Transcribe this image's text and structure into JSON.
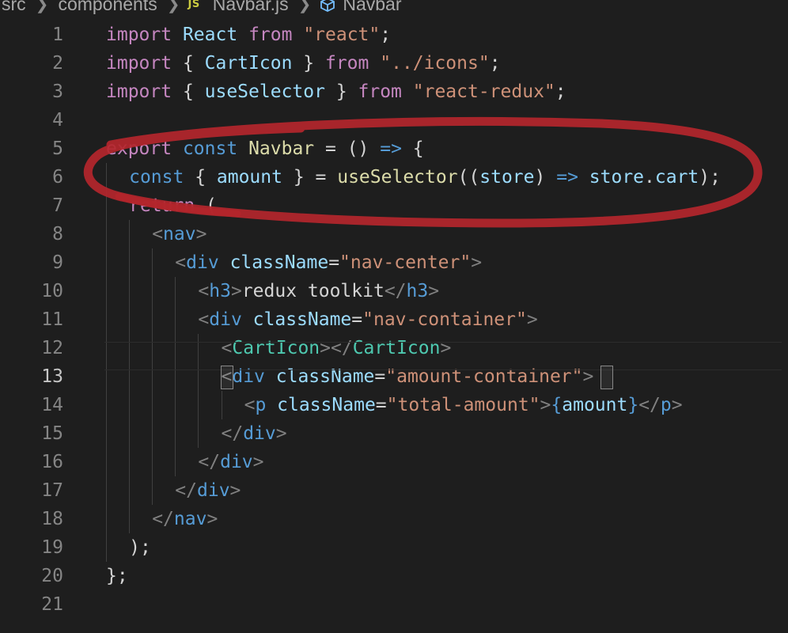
{
  "breadcrumb": {
    "segments": [
      "src",
      "components",
      "Navbar.js",
      "Navbar"
    ],
    "file_icon_label": "JS"
  },
  "editor": {
    "active_line": 13,
    "colors": {
      "background": "#1e1e1e",
      "annotation": "#b4262c"
    },
    "lines": [
      {
        "n": "1",
        "indent": 0,
        "tokens": [
          [
            "kw",
            "import"
          ],
          [
            "pun",
            " "
          ],
          [
            "var",
            "React"
          ],
          [
            "pun",
            " "
          ],
          [
            "kw",
            "from"
          ],
          [
            "pun",
            " "
          ],
          [
            "str",
            "\"react\""
          ],
          [
            "pun",
            ";"
          ]
        ]
      },
      {
        "n": "2",
        "indent": 0,
        "tokens": [
          [
            "kw",
            "import"
          ],
          [
            "pun",
            " { "
          ],
          [
            "var",
            "CartIcon"
          ],
          [
            "pun",
            " } "
          ],
          [
            "kw",
            "from"
          ],
          [
            "pun",
            " "
          ],
          [
            "str",
            "\"../icons\""
          ],
          [
            "pun",
            ";"
          ]
        ]
      },
      {
        "n": "3",
        "indent": 0,
        "tokens": [
          [
            "kw",
            "import"
          ],
          [
            "pun",
            " { "
          ],
          [
            "var",
            "useSelector"
          ],
          [
            "pun",
            " } "
          ],
          [
            "kw",
            "from"
          ],
          [
            "pun",
            " "
          ],
          [
            "str",
            "\"react-redux\""
          ],
          [
            "pun",
            ";"
          ]
        ]
      },
      {
        "n": "4",
        "indent": 0,
        "tokens": []
      },
      {
        "n": "5",
        "indent": 0,
        "tokens": [
          [
            "kw",
            "export"
          ],
          [
            "pun",
            " "
          ],
          [
            "st",
            "const"
          ],
          [
            "pun",
            " "
          ],
          [
            "fn",
            "Navbar"
          ],
          [
            "pun",
            " = () "
          ],
          [
            "st",
            "=>"
          ],
          [
            "pun",
            " {"
          ]
        ]
      },
      {
        "n": "6",
        "indent": 1,
        "tokens": [
          [
            "st",
            "const"
          ],
          [
            "pun",
            " { "
          ],
          [
            "var",
            "amount"
          ],
          [
            "pun",
            " } = "
          ],
          [
            "fn",
            "useSelector"
          ],
          [
            "pun",
            "(("
          ],
          [
            "var",
            "store"
          ],
          [
            "pun",
            ") "
          ],
          [
            "st",
            "=>"
          ],
          [
            "pun",
            " "
          ],
          [
            "var",
            "store"
          ],
          [
            "pun",
            "."
          ],
          [
            "var",
            "cart"
          ],
          [
            "pun",
            ");"
          ]
        ]
      },
      {
        "n": "7",
        "indent": 1,
        "tokens": [
          [
            "kw",
            "return"
          ],
          [
            "pun",
            " ("
          ]
        ]
      },
      {
        "n": "8",
        "indent": 2,
        "tokens": [
          [
            "tpu",
            "<"
          ],
          [
            "tag",
            "nav"
          ],
          [
            "tpu",
            ">"
          ]
        ]
      },
      {
        "n": "9",
        "indent": 3,
        "tokens": [
          [
            "tpu",
            "<"
          ],
          [
            "tag",
            "div"
          ],
          [
            "pun",
            " "
          ],
          [
            "att",
            "className"
          ],
          [
            "pun",
            "="
          ],
          [
            "str",
            "\"nav-center\""
          ],
          [
            "tpu",
            ">"
          ]
        ]
      },
      {
        "n": "10",
        "indent": 4,
        "tokens": [
          [
            "tpu",
            "<"
          ],
          [
            "tag",
            "h3"
          ],
          [
            "tpu",
            ">"
          ],
          [
            "txt",
            "redux toolkit"
          ],
          [
            "tpu",
            "</"
          ],
          [
            "tag",
            "h3"
          ],
          [
            "tpu",
            ">"
          ]
        ]
      },
      {
        "n": "11",
        "indent": 4,
        "tokens": [
          [
            "tpu",
            "<"
          ],
          [
            "tag",
            "div"
          ],
          [
            "pun",
            " "
          ],
          [
            "att",
            "className"
          ],
          [
            "pun",
            "="
          ],
          [
            "str",
            "\"nav-container\""
          ],
          [
            "tpu",
            ">"
          ]
        ]
      },
      {
        "n": "12",
        "indent": 5,
        "tokens": [
          [
            "tpu",
            "<"
          ],
          [
            "cmp",
            "CartIcon"
          ],
          [
            "tpu",
            "></"
          ],
          [
            "cmp",
            "CartIcon"
          ],
          [
            "tpu",
            ">"
          ]
        ]
      },
      {
        "n": "13",
        "indent": 5,
        "tokens": [
          [
            "tpu",
            "<"
          ],
          [
            "tag",
            "div"
          ],
          [
            "pun",
            " "
          ],
          [
            "att",
            "className"
          ],
          [
            "pun",
            "="
          ],
          [
            "str",
            "\"amount-container\""
          ],
          [
            "tpu",
            ">"
          ]
        ]
      },
      {
        "n": "14",
        "indent": 6,
        "tokens": [
          [
            "tpu",
            "<"
          ],
          [
            "tag",
            "p"
          ],
          [
            "pun",
            " "
          ],
          [
            "att",
            "className"
          ],
          [
            "pun",
            "="
          ],
          [
            "str",
            "\"total-amount\""
          ],
          [
            "tpu",
            ">"
          ],
          [
            "st",
            "{"
          ],
          [
            "var",
            "amount"
          ],
          [
            "st",
            "}"
          ],
          [
            "tpu",
            "</"
          ],
          [
            "tag",
            "p"
          ],
          [
            "tpu",
            ">"
          ]
        ]
      },
      {
        "n": "15",
        "indent": 5,
        "tokens": [
          [
            "tpu",
            "</"
          ],
          [
            "tag",
            "div"
          ],
          [
            "tpu",
            ">"
          ]
        ]
      },
      {
        "n": "16",
        "indent": 4,
        "tokens": [
          [
            "tpu",
            "</"
          ],
          [
            "tag",
            "div"
          ],
          [
            "tpu",
            ">"
          ]
        ]
      },
      {
        "n": "17",
        "indent": 3,
        "tokens": [
          [
            "tpu",
            "</"
          ],
          [
            "tag",
            "div"
          ],
          [
            "tpu",
            ">"
          ]
        ]
      },
      {
        "n": "18",
        "indent": 2,
        "tokens": [
          [
            "tpu",
            "</"
          ],
          [
            "tag",
            "nav"
          ],
          [
            "tpu",
            ">"
          ]
        ]
      },
      {
        "n": "19",
        "indent": 1,
        "tokens": [
          [
            "pun",
            ");"
          ]
        ]
      },
      {
        "n": "20",
        "indent": 0,
        "tokens": [
          [
            "pun",
            "};"
          ]
        ]
      },
      {
        "n": "21",
        "indent": 0,
        "tokens": []
      }
    ]
  }
}
